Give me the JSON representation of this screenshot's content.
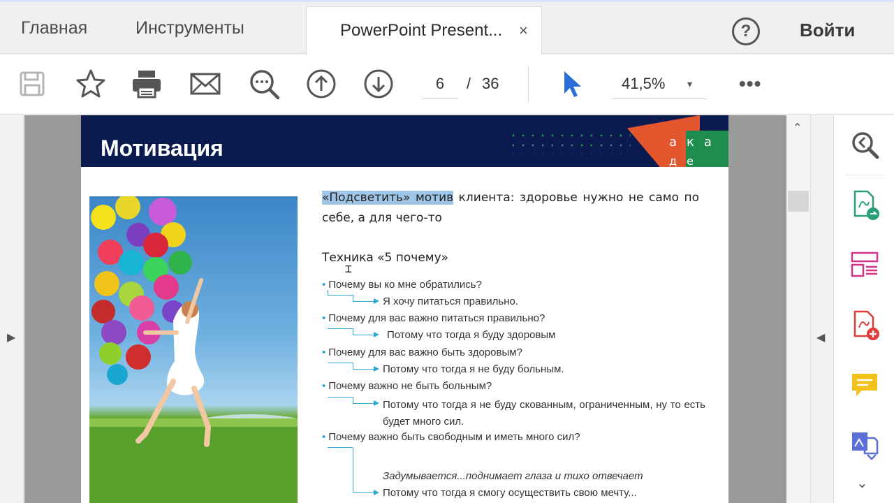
{
  "tabs": {
    "home": "Главная",
    "tools": "Инструменты",
    "document": "PowerPoint Present...",
    "close": "×"
  },
  "header": {
    "help": "?",
    "signin": "Войти"
  },
  "toolbar": {
    "icons": [
      "save-icon",
      "star-icon",
      "print-icon",
      "mail-icon",
      "zoom-search-icon",
      "page-up-icon",
      "page-down-icon",
      "select-cursor-icon",
      "more-icon"
    ],
    "page_current": "6",
    "page_separator": "/",
    "page_total": "36",
    "zoom": "41,5%",
    "zoom_caret": "▾",
    "more": "•••"
  },
  "slide": {
    "title": "Мотивация",
    "logo_top": "ака",
    "logo_bottom": "де",
    "intro_highlight": "«Подсветить» мотив",
    "intro_rest": " клиента: здоровье нужно не само по себе, а для чего-то",
    "technique": "Техника «5 почему»",
    "q1": "Почему вы ко мне обратились?",
    "a1": "Я хочу питаться правильно.",
    "q2": "Почему для вас важно питаться правильно?",
    "a2": "Потому что тогда я буду здоровым",
    "q3": "Почему для вас важно быть здоровым?",
    "a3": "Потому что тогда я не буду больным.",
    "q4": "Почему важно не быть больным?",
    "a4": "Потому что тогда я не буду скованным, ограниченным, ну то есть будет много сил.",
    "q5": "Почему важно быть свободным и иметь много сил?",
    "thinking": "Задумывается...поднимает глаза и тихо отвечает",
    "a5": "Потому что тогда я смогу осуществить свою мечту..."
  },
  "colors": {
    "slide_header": "#0b1a4f",
    "highlight": "#9fc6e6",
    "connector": "#2aa5d8",
    "logo_orange": "#e4572e",
    "logo_green": "#1f8d4e"
  },
  "right_tools": [
    "zoom-tool-icon",
    "export-pdf-icon",
    "organize-pages-icon",
    "create-pdf-icon",
    "comment-icon",
    "edit-pdf-icon"
  ]
}
